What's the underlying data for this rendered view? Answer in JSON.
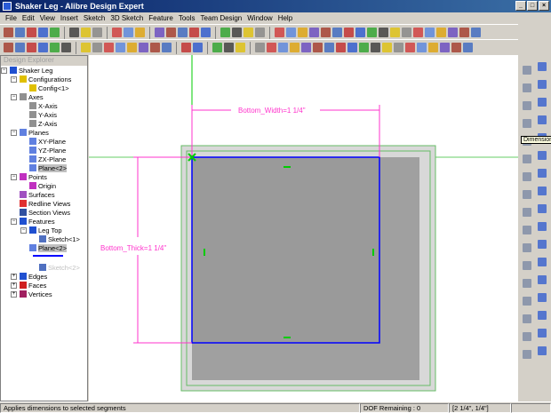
{
  "window": {
    "title": "Shaker Leg - Alibre Design Expert"
  },
  "menu": [
    "File",
    "Edit",
    "View",
    "Insert",
    "Sketch",
    "3D Sketch",
    "Feature",
    "Tools",
    "Team Design",
    "Window",
    "Help"
  ],
  "explorer": {
    "header": "Design Explorer",
    "items": [
      {
        "label": "Shaker Leg",
        "icon": "part-icon"
      },
      {
        "label": "Configurations",
        "icon": "configuration-icon"
      },
      {
        "label": "Config<1>",
        "icon": "configuration-icon"
      },
      {
        "label": "Axes",
        "icon": "axis-icon"
      },
      {
        "label": "X-Axis",
        "icon": "axis-icon"
      },
      {
        "label": "Y-Axis",
        "icon": "axis-icon"
      },
      {
        "label": "Z-Axis",
        "icon": "axis-icon"
      },
      {
        "label": "Planes",
        "icon": "plane-icon"
      },
      {
        "label": "XY-Plane",
        "icon": "plane-icon"
      },
      {
        "label": "YZ-Plane",
        "icon": "plane-icon"
      },
      {
        "label": "ZX-Plane",
        "icon": "plane-icon"
      },
      {
        "label": "Plane<2>",
        "icon": "plane-icon"
      },
      {
        "label": "Points",
        "icon": "point-icon"
      },
      {
        "label": "Origin",
        "icon": "point-icon"
      },
      {
        "label": "Surfaces",
        "icon": "surface-icon"
      },
      {
        "label": "Redline Views",
        "icon": "redline-icon"
      },
      {
        "label": "Section Views",
        "icon": "section-icon"
      },
      {
        "label": "Features",
        "icon": "features-icon"
      },
      {
        "label": "Leg Top",
        "icon": "extrude-icon"
      },
      {
        "label": "Sketch<1>",
        "icon": "sketch-icon"
      },
      {
        "label": "Plane<2>",
        "icon": "plane-icon"
      },
      {
        "label": "Sketch<2>",
        "icon": "sketch-icon"
      },
      {
        "label": "Edges",
        "icon": "edges-icon"
      },
      {
        "label": "Faces",
        "icon": "faces-icon"
      },
      {
        "label": "Vertices",
        "icon": "vertices-icon"
      }
    ]
  },
  "canvas": {
    "width_dim": "Bottom_Width=1 1/4\"",
    "thick_dim": "Bottom_Thick=1 1/4\""
  },
  "tooltip": "Dimension",
  "status": {
    "message": "Applies dimensions to selected segments",
    "dof": "DOF Remaining : 0",
    "coords": "[2 1/4\", 1/4\"]"
  },
  "colors": {
    "sketch": "#0000ff",
    "dimension": "#ff33cc",
    "constraint": "#00cc00",
    "face": "#a0a0a0"
  }
}
